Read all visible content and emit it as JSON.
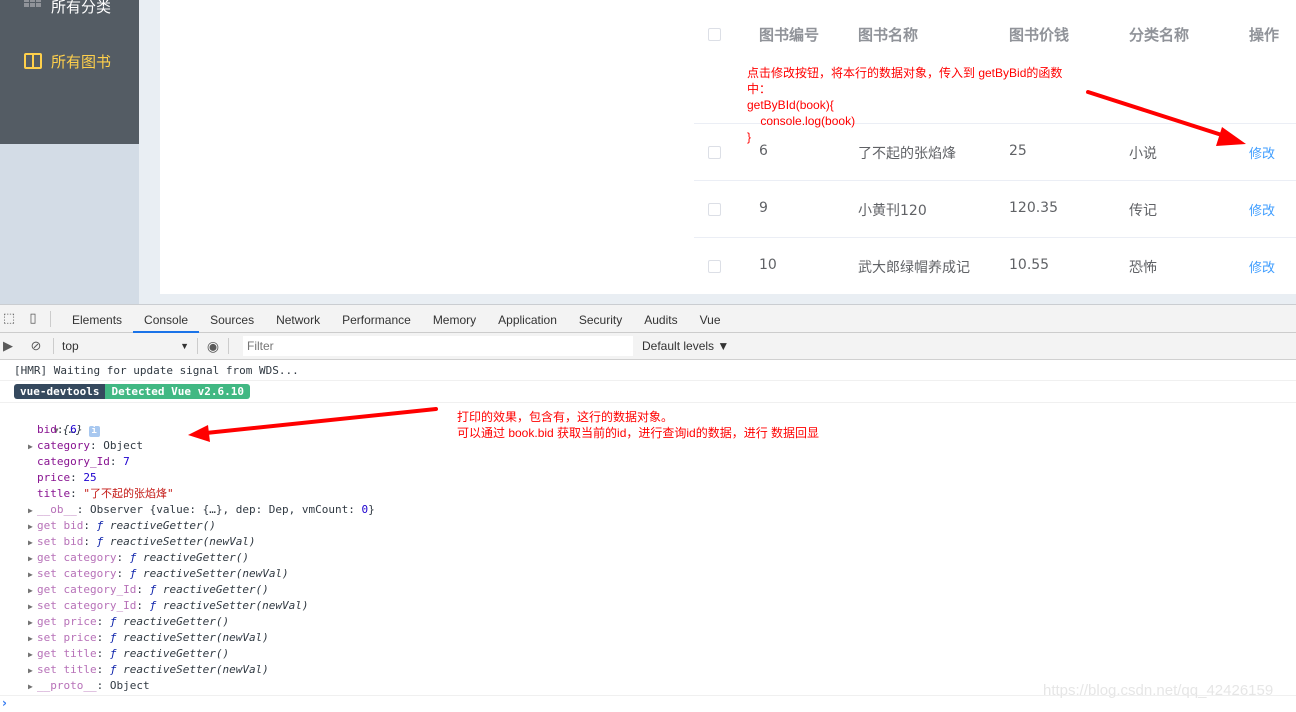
{
  "sidebar": {
    "items": [
      {
        "label": "所有分类",
        "icon": "grid-icon",
        "active": false
      },
      {
        "label": "所有图书",
        "icon": "book-icon",
        "active": true
      }
    ],
    "active_color": "#ffd04b"
  },
  "table": {
    "headers": [
      "图书编号",
      "图书名称",
      "图书价钱",
      "分类名称",
      "操作"
    ],
    "rows": [
      {
        "id": "6",
        "name": "了不起的张焰烽",
        "price": "25",
        "category": "小说",
        "action": "修改"
      },
      {
        "id": "9",
        "name": "小黄刊120",
        "price": "120.35",
        "category": "传记",
        "action": "修改"
      },
      {
        "id": "10",
        "name": "武大郎绿帽养成记",
        "price": "10.55",
        "category": "恐怖",
        "action": "修改"
      }
    ],
    "link_color": "#409eff"
  },
  "annotations": {
    "top": "点击修改按钮，将本行的数据对象，传入到 getByBid的函数\n中：\ngetByBId(book){\n    console.log(book)\n}",
    "console": "打印的效果，包含有，这行的数据对象。\n可以通过 book.bid 获取当前的id，进行查询id的数据，进行 数据回显",
    "color": "#ff0000"
  },
  "devtools": {
    "tabs": [
      "Elements",
      "Console",
      "Sources",
      "Network",
      "Performance",
      "Memory",
      "Application",
      "Security",
      "Audits",
      "Vue"
    ],
    "active_tab": "Console",
    "context": "top",
    "filter_placeholder": "Filter",
    "levels": "Default levels ▼",
    "console": {
      "hmr": "[HMR] Waiting for update signal from WDS...",
      "badge_left": "vue-devtools",
      "badge_right": "Detected Vue v2.6.10",
      "object_summary": "{…}",
      "props": [
        {
          "key": "bid",
          "value": "6",
          "type": "num"
        },
        {
          "key": "category",
          "value": "Object",
          "type": "obj",
          "expandable": true
        },
        {
          "key": "category_Id",
          "value": "7",
          "type": "num"
        },
        {
          "key": "price",
          "value": "25",
          "type": "num"
        },
        {
          "key": "title",
          "value": "\"了不起的张焰烽\"",
          "type": "str"
        }
      ],
      "ob": {
        "key": "__ob__",
        "value": "Observer {value: {…}, dep: Dep, vmCount: ",
        "count": "0",
        "end": "}"
      },
      "accessors": [
        {
          "key": "get bid",
          "fn": "reactiveGetter()"
        },
        {
          "key": "set bid",
          "fn": "reactiveSetter(newVal)"
        },
        {
          "key": "get category",
          "fn": "reactiveGetter()"
        },
        {
          "key": "set category",
          "fn": "reactiveSetter(newVal)"
        },
        {
          "key": "get category_Id",
          "fn": "reactiveGetter()"
        },
        {
          "key": "set category_Id",
          "fn": "reactiveSetter(newVal)"
        },
        {
          "key": "get price",
          "fn": "reactiveGetter()"
        },
        {
          "key": "set price",
          "fn": "reactiveSetter(newVal)"
        },
        {
          "key": "get title",
          "fn": "reactiveGetter()"
        },
        {
          "key": "set title",
          "fn": "reactiveSetter(newVal)"
        }
      ],
      "proto": {
        "key": "__proto__",
        "value": "Object"
      },
      "prompt": "›"
    }
  },
  "watermark": "https://blog.csdn.net/qq_42426159"
}
